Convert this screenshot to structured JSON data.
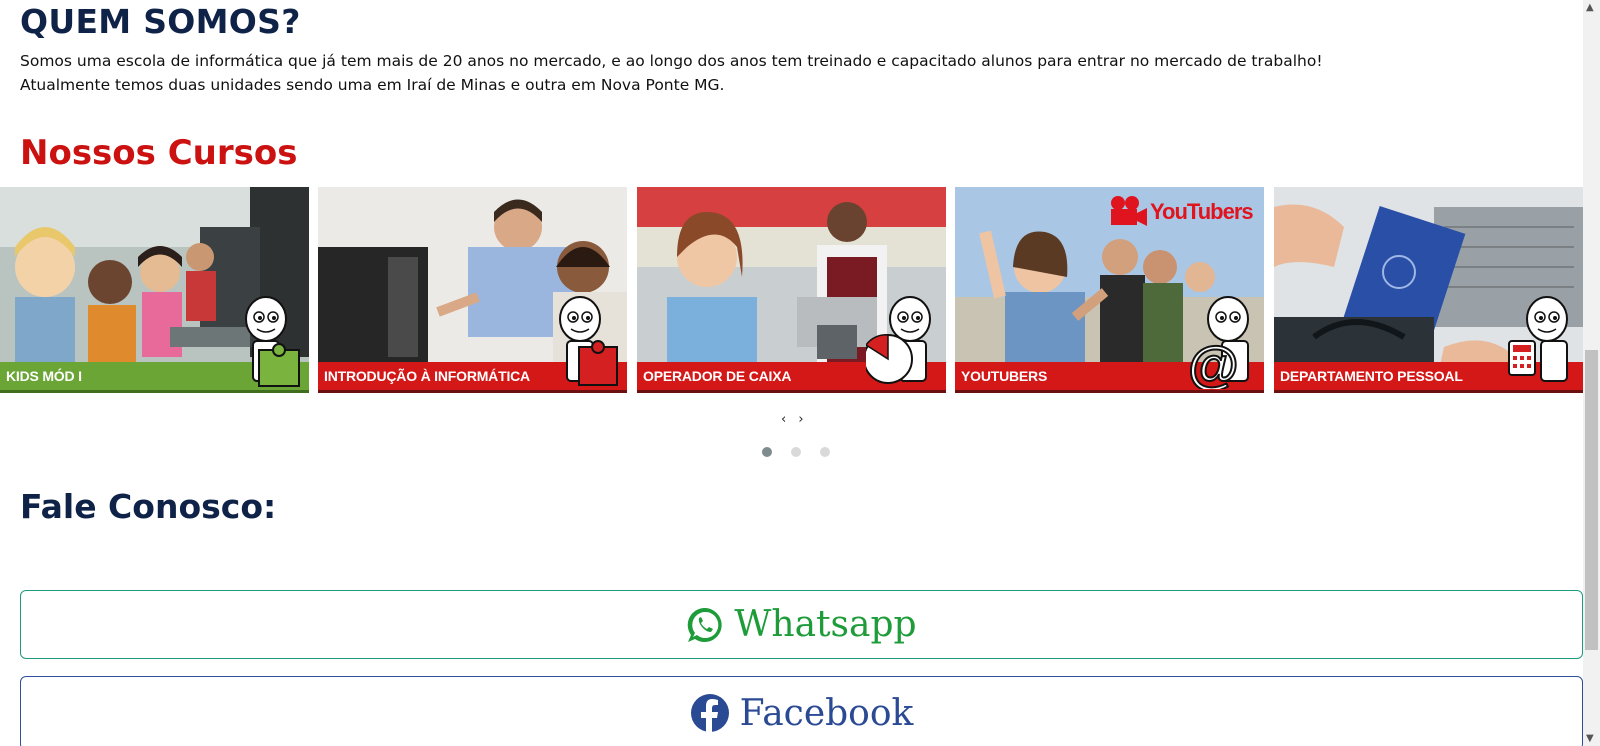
{
  "about": {
    "title": "QUEM SOMOS?",
    "line1": "Somos uma escola de informática que já tem mais de 20 anos no mercado, e ao longo dos anos tem treinado e capacitado alunos para entrar no mercado de trabalho!",
    "line2": "Atualmente temos duas unidades sendo uma em Iraí de Minas e outra em Nova Ponte MG."
  },
  "courses": {
    "title": "Nossos Cursos",
    "items": [
      {
        "label": "KIDS MÓD I",
        "band_color": "#6aa536"
      },
      {
        "label": "INTRODUÇÃO À INFORMÁTICA",
        "band_color": "#d41818"
      },
      {
        "label": "OPERADOR DE CAIXA",
        "band_color": "#d41818"
      },
      {
        "label": "YOUTUBERS",
        "band_color": "#d41818",
        "brand_text": "YouTubers"
      },
      {
        "label": "DEPARTAMENTO PESSOAL",
        "band_color": "#d41818"
      }
    ],
    "prev": "‹",
    "next": "›",
    "dots_active": 1,
    "dots_total": 3
  },
  "contact": {
    "title": "Fale Conosco:",
    "whatsapp_label": "Whatsapp",
    "facebook_label": "Facebook",
    "whatsapp_color": "#1f9c3a",
    "facebook_color": "#2b4a94"
  },
  "icons": {
    "whatsapp": "whatsapp-icon",
    "facebook": "facebook-icon",
    "mascot": "mascot-icon"
  }
}
